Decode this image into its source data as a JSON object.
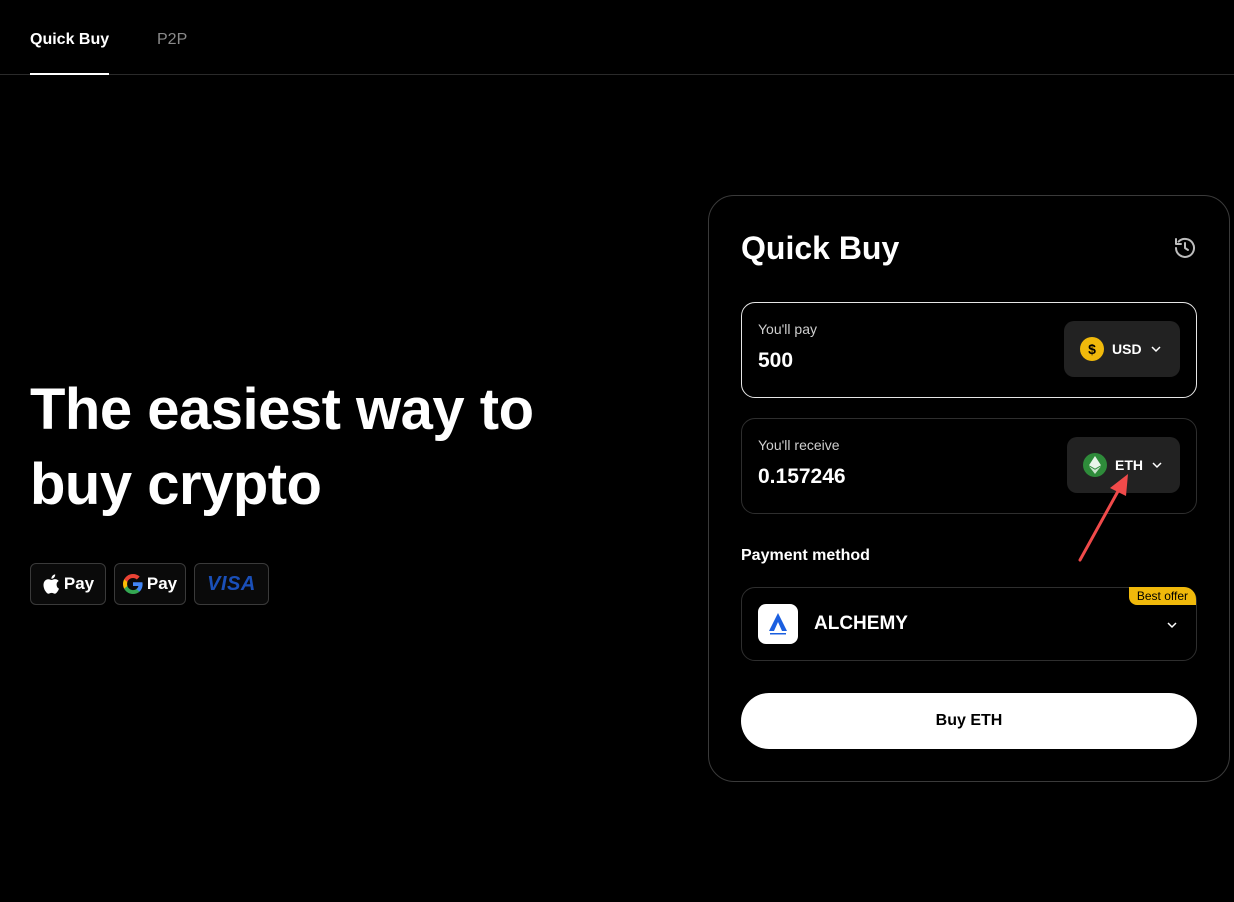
{
  "nav": {
    "tabs": [
      {
        "label": "Quick Buy",
        "active": true
      },
      {
        "label": "P2P",
        "active": false
      }
    ]
  },
  "hero": {
    "title_line1": "The easiest way to",
    "title_line2": "buy crypto",
    "badges": {
      "apple": "Pay",
      "google": "Pay",
      "visa": "VISA"
    }
  },
  "card": {
    "title": "Quick Buy",
    "pay": {
      "label": "You'll pay",
      "value": "500",
      "currency": "USD",
      "currency_symbol": "$"
    },
    "receive": {
      "label": "You'll receive",
      "value": "0.157246",
      "currency": "ETH"
    },
    "payment_method": {
      "label": "Payment method",
      "provider": "ALCHEMY",
      "badge": "Best offer"
    },
    "buy_button": "Buy ETH"
  },
  "colors": {
    "background": "#000000",
    "accent_yellow": "#f0b90b",
    "eth_green": "#2e8b3a",
    "annotation_arrow": "#f04a4a"
  }
}
